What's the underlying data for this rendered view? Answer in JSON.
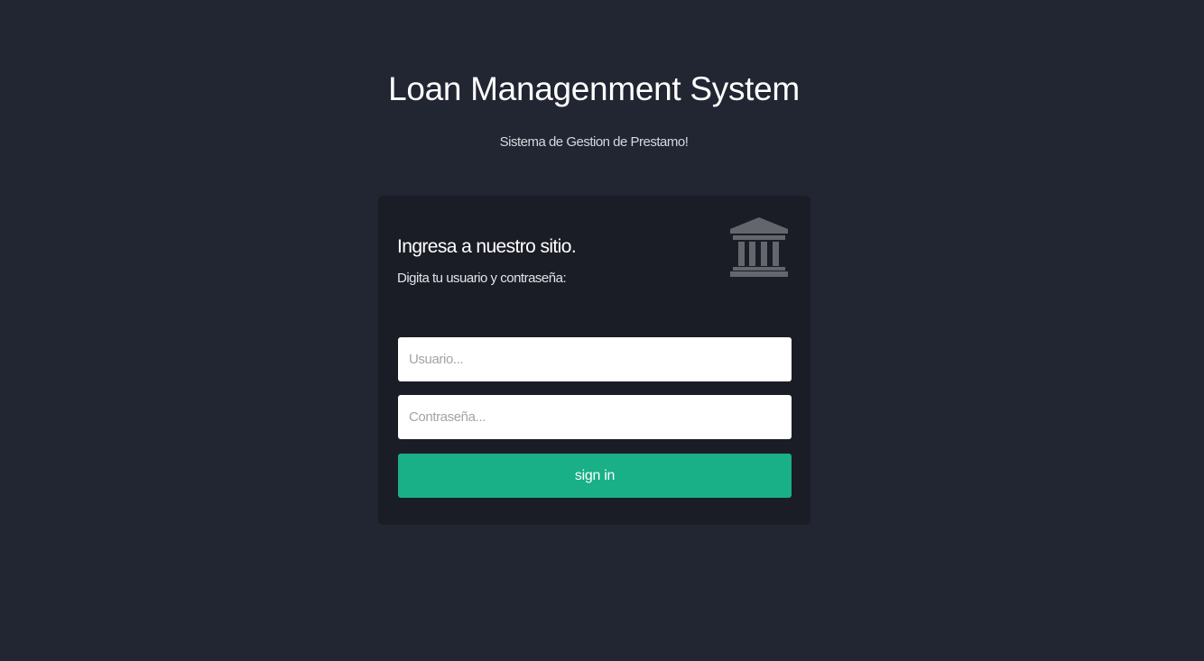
{
  "header": {
    "title": "Loan Managenment System",
    "subtitle": "Sistema de Gestion de Prestamo!"
  },
  "login": {
    "heading": "Ingresa a nuestro sitio.",
    "subheading": "Digita tu usuario y contraseña:",
    "icon": "bank-icon",
    "username": {
      "value": "",
      "placeholder": "Usuario..."
    },
    "password": {
      "value": "",
      "placeholder": "Contraseña..."
    },
    "submit_label": "sign in"
  },
  "colors": {
    "background": "#222532",
    "card": "#1b1d26",
    "accent": "#19af87",
    "icon": "#63666d"
  }
}
